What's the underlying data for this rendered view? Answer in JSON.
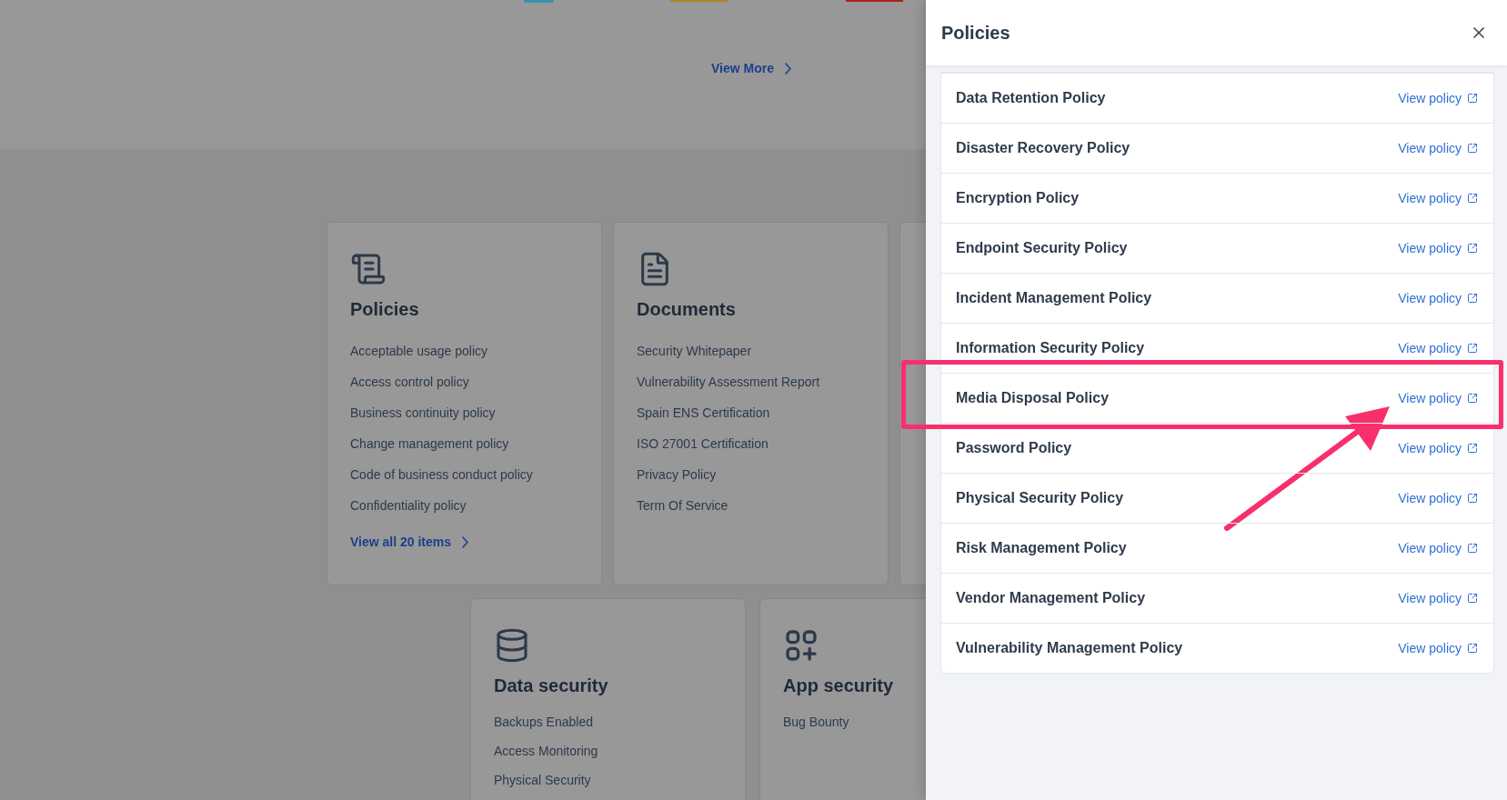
{
  "page": {
    "view_more": "View More",
    "card_rows": [
      [
        {
          "kind": "scroll",
          "title": "Policies",
          "items": [
            "Acceptable usage policy",
            "Access control policy",
            "Business continuity policy",
            "Change management policy",
            "Code of business conduct policy",
            "Confidentiality policy"
          ],
          "footer_link": "View all 20 items"
        },
        {
          "kind": "document",
          "title": "Documents",
          "items": [
            "Security Whitepaper",
            "Vulnerability Assessment Report",
            "Spain ENS Certification",
            "ISO 27001 Certification",
            "Privacy Policy",
            "Term Of Service"
          ]
        }
      ],
      [
        {
          "kind": "database",
          "title": "Data security",
          "items": [
            "Backups Enabled",
            "Access Monitoring",
            "Physical Security"
          ]
        },
        {
          "kind": "apps",
          "title": "App security",
          "items": [
            "Bug Bounty"
          ]
        }
      ]
    ]
  },
  "drawer": {
    "title": "Policies",
    "rows": [
      {
        "name": "Data Retention Policy",
        "link": "View policy",
        "highlighted": false
      },
      {
        "name": "Disaster Recovery Policy",
        "link": "View policy",
        "highlighted": false
      },
      {
        "name": "Encryption Policy",
        "link": "View policy",
        "highlighted": false
      },
      {
        "name": "Endpoint Security Policy",
        "link": "View policy",
        "highlighted": false
      },
      {
        "name": "Incident Management Policy",
        "link": "View policy",
        "highlighted": false
      },
      {
        "name": "Information Security Policy",
        "link": "View policy",
        "highlighted": false
      },
      {
        "name": "Media Disposal Policy",
        "link": "View policy",
        "highlighted": true
      },
      {
        "name": "Password Policy",
        "link": "View policy",
        "highlighted": false
      },
      {
        "name": "Physical Security Policy",
        "link": "View policy",
        "highlighted": false
      },
      {
        "name": "Risk Management Policy",
        "link": "View policy",
        "highlighted": false
      },
      {
        "name": "Vendor Management Policy",
        "link": "View policy",
        "highlighted": false
      },
      {
        "name": "Vulnerability Management Policy",
        "link": "View policy",
        "highlighted": false
      }
    ]
  }
}
